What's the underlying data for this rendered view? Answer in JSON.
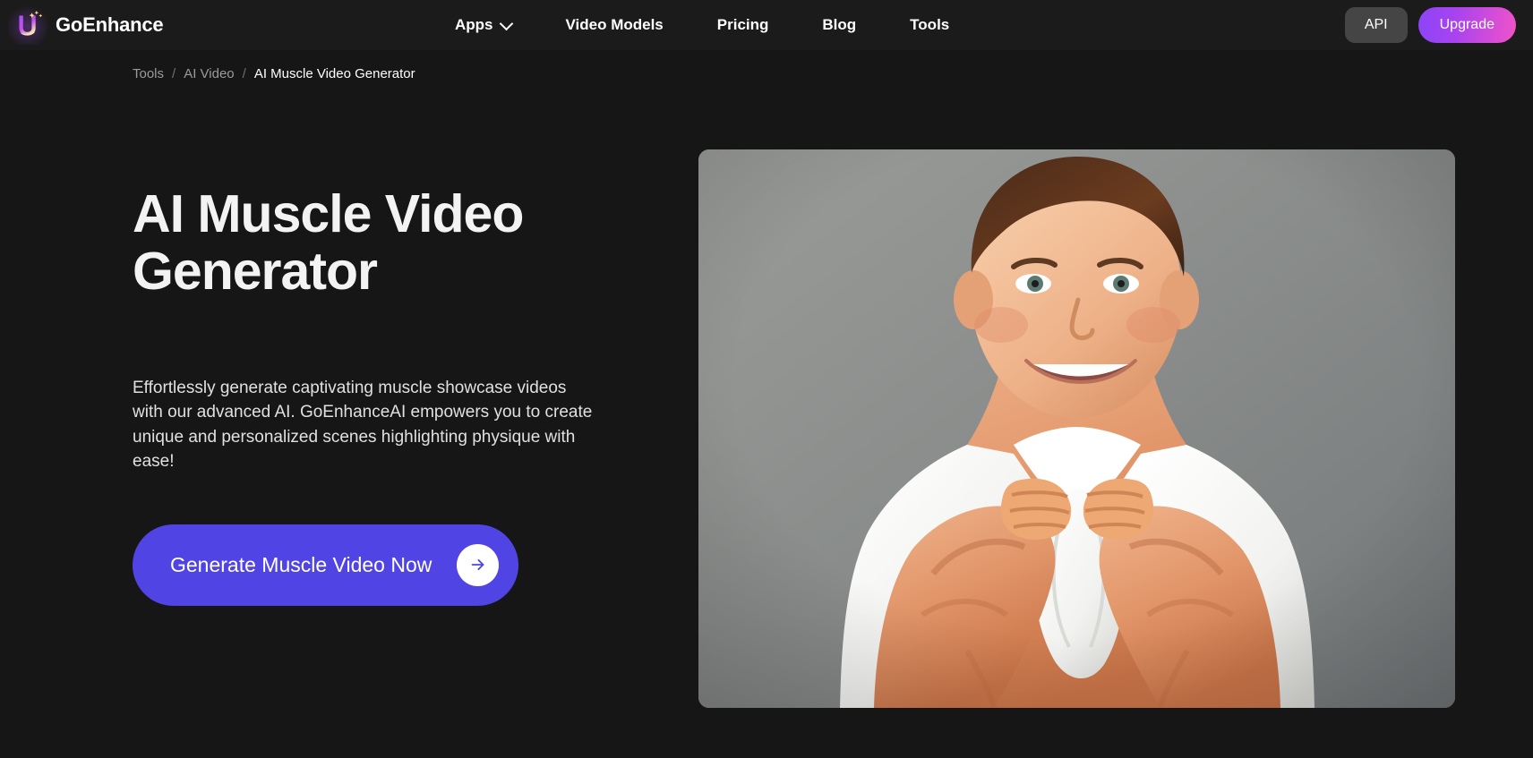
{
  "brand": {
    "name": "GoEnhance",
    "logo_icon": "u-sparkle-logo-icon"
  },
  "nav": {
    "items": [
      {
        "label": "Apps",
        "has_dropdown": true,
        "icon": "chevron-down-icon"
      },
      {
        "label": "Video Models",
        "has_dropdown": false
      },
      {
        "label": "Pricing",
        "has_dropdown": false
      },
      {
        "label": "Blog",
        "has_dropdown": false
      },
      {
        "label": "Tools",
        "has_dropdown": false
      }
    ]
  },
  "header_actions": {
    "api_label": "API",
    "upgrade_label": "Upgrade"
  },
  "breadcrumb": {
    "items": [
      "Tools",
      "AI Video",
      "AI Muscle Video Generator"
    ],
    "separator": "/"
  },
  "hero": {
    "title": "AI Muscle Video Generator",
    "description": "Effortlessly generate captivating muscle showcase videos with our advanced AI. GoEnhanceAI empowers you to create unique and personalized scenes highlighting physique with ease!",
    "cta_label": "Generate Muscle Video Now",
    "cta_icon": "arrow-right-icon",
    "media_alt": "Smiling boy with brown hair pulling open a white shirt revealing muscular arms against a grey wall"
  },
  "colors": {
    "page_background": "#161616",
    "header_background": "#1b1b1b",
    "cta_blue": "#5144e4",
    "upgrade_gradient_start": "#8b45f7",
    "upgrade_gradient_end": "#f053c8",
    "api_button": "#454545",
    "breadcrumb_muted": "#9b9b9b",
    "text_primary": "#ffffff"
  }
}
